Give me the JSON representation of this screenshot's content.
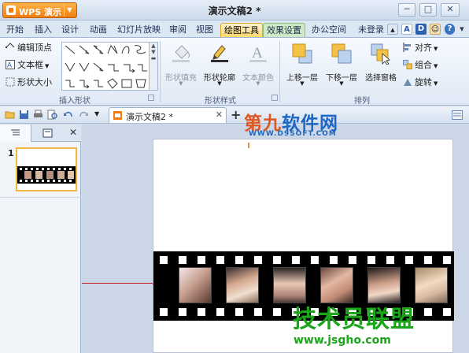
{
  "app": {
    "brand": "WPS 演示",
    "doc_title": "演示文稿2 *",
    "window_buttons": [
      "─",
      "□",
      "✕"
    ]
  },
  "menu": {
    "tabs": [
      "开始",
      "插入",
      "设计",
      "动画",
      "幻灯片放映",
      "审阅",
      "视图",
      "绘图工具",
      "效果设置",
      "办公空间"
    ],
    "active_tab": "绘图工具",
    "login": "未登录",
    "right_icons": [
      "A",
      "D",
      "?"
    ]
  },
  "ribbon": {
    "edit_points": "编辑顶点",
    "text_box": "文本框",
    "shape_size": "形状大小",
    "group_insert_shape": "插入形状",
    "shape_fill": "形状填充",
    "shape_outline": "形状轮廓",
    "text_color": "文本颜色",
    "group_shape_style": "形状样式",
    "bring_forward": "上移一层",
    "send_backward": "下移一层",
    "selection_pane": "选择窗格",
    "align": "对齐",
    "group": "组合",
    "rotate": "旋转",
    "group_arrange": "排列",
    "colors": {
      "accent": "#f0a31a",
      "fill_icon": "#f4c247",
      "outline_pen": "#2e2e2e",
      "text_color_dim": "#9aa3b0"
    }
  },
  "doc_tabs": {
    "active": "演示文稿2 *",
    "add": "+"
  },
  "side_panel": {
    "slide_number": "1"
  },
  "watermarks": {
    "top_main_a": "第九",
    "top_main_b": "软件网",
    "top_sub": "WWW.D9SOFT.COM",
    "bottom_main": "技术员联盟",
    "bottom_sub": "www.jsgho.com"
  }
}
